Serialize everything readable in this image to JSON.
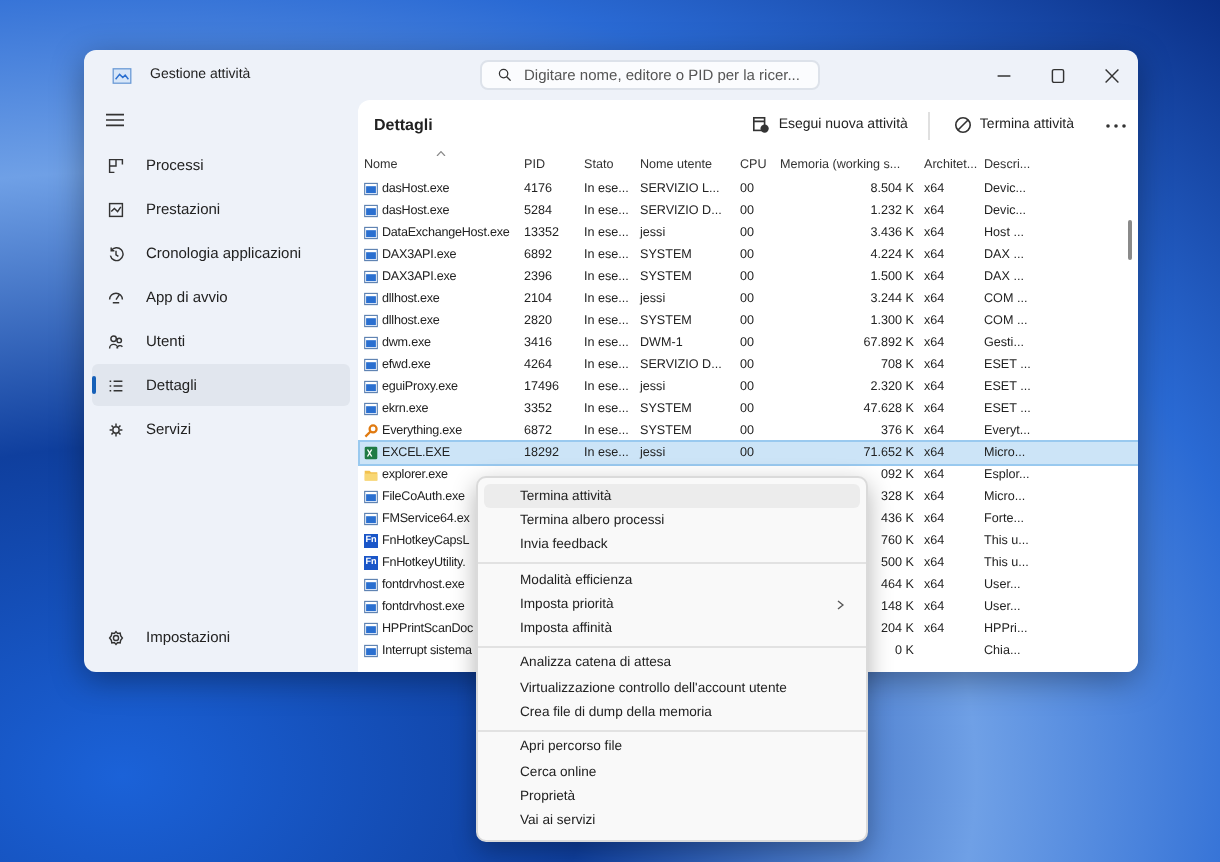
{
  "window": {
    "title": "Gestione attività"
  },
  "search": {
    "placeholder": "Digitare nome, editore o PID per la ricer..."
  },
  "sidebar": {
    "items": [
      {
        "label": "Processi",
        "kind": "processes",
        "selected": false
      },
      {
        "label": "Prestazioni",
        "kind": "performance",
        "selected": false
      },
      {
        "label": "Cronologia applicazioni",
        "kind": "history",
        "selected": false
      },
      {
        "label": "App di avvio",
        "kind": "startup",
        "selected": false
      },
      {
        "label": "Utenti",
        "kind": "users",
        "selected": false
      },
      {
        "label": "Dettagli",
        "kind": "details",
        "selected": true
      },
      {
        "label": "Servizi",
        "kind": "services",
        "selected": false
      }
    ],
    "footer": {
      "label": "Impostazioni",
      "kind": "settings"
    }
  },
  "header": {
    "title": "Dettagli",
    "actions": [
      {
        "label": "Esegui nuova attività",
        "kind": "run"
      },
      {
        "label": "Termina attività",
        "kind": "end"
      }
    ]
  },
  "table": {
    "columns": [
      "Nome",
      "PID",
      "Stato",
      "Nome utente",
      "CPU",
      "Memoria (working s...",
      "Architet...",
      "Descri..."
    ],
    "rows": [
      {
        "kind": "app",
        "name": "dasHost.exe",
        "pid": "4176",
        "status": "In ese...",
        "user": "SERVIZIO L...",
        "cpu": "00",
        "memory": "8.504 K",
        "arch": "x64",
        "description": "Devic...",
        "selected": false
      },
      {
        "kind": "app",
        "name": "dasHost.exe",
        "pid": "5284",
        "status": "In ese...",
        "user": "SERVIZIO D...",
        "cpu": "00",
        "memory": "1.232 K",
        "arch": "x64",
        "description": "Devic...",
        "selected": false
      },
      {
        "kind": "app",
        "name": "DataExchangeHost.exe",
        "pid": "13352",
        "status": "In ese...",
        "user": "jessi",
        "cpu": "00",
        "memory": "3.436 K",
        "arch": "x64",
        "description": "Host ...",
        "selected": false
      },
      {
        "kind": "app",
        "name": "DAX3API.exe",
        "pid": "6892",
        "status": "In ese...",
        "user": "SYSTEM",
        "cpu": "00",
        "memory": "4.224 K",
        "arch": "x64",
        "description": "DAX ...",
        "selected": false
      },
      {
        "kind": "app",
        "name": "DAX3API.exe",
        "pid": "2396",
        "status": "In ese...",
        "user": "SYSTEM",
        "cpu": "00",
        "memory": "1.500 K",
        "arch": "x64",
        "description": "DAX ...",
        "selected": false
      },
      {
        "kind": "app",
        "name": "dllhost.exe",
        "pid": "2104",
        "status": "In ese...",
        "user": "jessi",
        "cpu": "00",
        "memory": "3.244 K",
        "arch": "x64",
        "description": "COM ...",
        "selected": false
      },
      {
        "kind": "app",
        "name": "dllhost.exe",
        "pid": "2820",
        "status": "In ese...",
        "user": "SYSTEM",
        "cpu": "00",
        "memory": "1.300 K",
        "arch": "x64",
        "description": "COM ...",
        "selected": false
      },
      {
        "kind": "app",
        "name": "dwm.exe",
        "pid": "3416",
        "status": "In ese...",
        "user": "DWM-1",
        "cpu": "00",
        "memory": "67.892 K",
        "arch": "x64",
        "description": "Gesti...",
        "selected": false
      },
      {
        "kind": "app",
        "name": "efwd.exe",
        "pid": "4264",
        "status": "In ese...",
        "user": "SERVIZIO D...",
        "cpu": "00",
        "memory": "708 K",
        "arch": "x64",
        "description": "ESET ...",
        "selected": false
      },
      {
        "kind": "app",
        "name": "eguiProxy.exe",
        "pid": "17496",
        "status": "In ese...",
        "user": "jessi",
        "cpu": "00",
        "memory": "2.320 K",
        "arch": "x64",
        "description": "ESET ...",
        "selected": false
      },
      {
        "kind": "app",
        "name": "ekrn.exe",
        "pid": "3352",
        "status": "In ese...",
        "user": "SYSTEM",
        "cpu": "00",
        "memory": "47.628 K",
        "arch": "x64",
        "description": "ESET ...",
        "selected": false
      },
      {
        "kind": "key",
        "name": "Everything.exe",
        "pid": "6872",
        "status": "In ese...",
        "user": "SYSTEM",
        "cpu": "00",
        "memory": "376 K",
        "arch": "x64",
        "description": "Everyt...",
        "selected": false
      },
      {
        "kind": "excel",
        "name": "EXCEL.EXE",
        "pid": "18292",
        "status": "In ese...",
        "user": "jessi",
        "cpu": "00",
        "memory": "71.652 K",
        "arch": "x64",
        "description": "Micro...",
        "selected": true
      },
      {
        "kind": "folder",
        "name": "explorer.exe",
        "memory": "092 K",
        "arch": "x64",
        "description": "Esplor...",
        "selected": false
      },
      {
        "kind": "app",
        "name": "FileCoAuth.exe",
        "memory": "328 K",
        "arch": "x64",
        "description": "Micro...",
        "selected": false
      },
      {
        "kind": "app",
        "name": "FMService64.ex",
        "memory": "436 K",
        "arch": "x64",
        "description": "Forte...",
        "selected": false
      },
      {
        "kind": "fn",
        "icon_text": "Fn",
        "name": "FnHotkeyCapsL",
        "memory": "760 K",
        "arch": "x64",
        "description": "This u...",
        "selected": false
      },
      {
        "kind": "fn",
        "icon_text": "Fn",
        "name": "FnHotkeyUtility.",
        "memory": "500 K",
        "arch": "x64",
        "description": "This u...",
        "selected": false
      },
      {
        "kind": "app",
        "name": "fontdrvhost.exe",
        "memory": "464 K",
        "arch": "x64",
        "description": "User...",
        "selected": false
      },
      {
        "kind": "app",
        "name": "fontdrvhost.exe",
        "memory": "148 K",
        "arch": "x64",
        "description": "User...",
        "selected": false
      },
      {
        "kind": "app",
        "name": "HPPrintScanDoc",
        "memory": "204 K",
        "arch": "x64",
        "description": "HPPri...",
        "selected": false
      },
      {
        "kind": "app",
        "name": "Interrupt sistema",
        "memory": "0 K",
        "description": "Chia...",
        "selected": false
      }
    ]
  },
  "context_menu": {
    "groups": [
      [
        {
          "label": "Termina attività",
          "selected": true,
          "submenu": false
        },
        {
          "label": "Termina albero processi",
          "selected": false,
          "submenu": false
        },
        {
          "label": "Invia feedback",
          "selected": false,
          "submenu": false
        }
      ],
      [
        {
          "label": "Modalità efficienza",
          "selected": false,
          "submenu": false
        },
        {
          "label": "Imposta priorità",
          "selected": false,
          "submenu": true
        },
        {
          "label": "Imposta affinità",
          "selected": false,
          "submenu": false
        }
      ],
      [
        {
          "label": "Analizza catena di attesa",
          "selected": false,
          "submenu": false
        },
        {
          "label": "Virtualizzazione controllo dell'account utente",
          "selected": false,
          "submenu": false
        },
        {
          "label": "Crea file di dump della memoria",
          "selected": false,
          "submenu": false
        }
      ],
      [
        {
          "label": "Apri percorso file",
          "selected": false,
          "submenu": false
        },
        {
          "label": "Cerca online",
          "selected": false,
          "submenu": false
        },
        {
          "label": "Proprietà",
          "selected": false,
          "submenu": false
        },
        {
          "label": "Vai ai servizi",
          "selected": false,
          "submenu": false
        }
      ]
    ]
  }
}
